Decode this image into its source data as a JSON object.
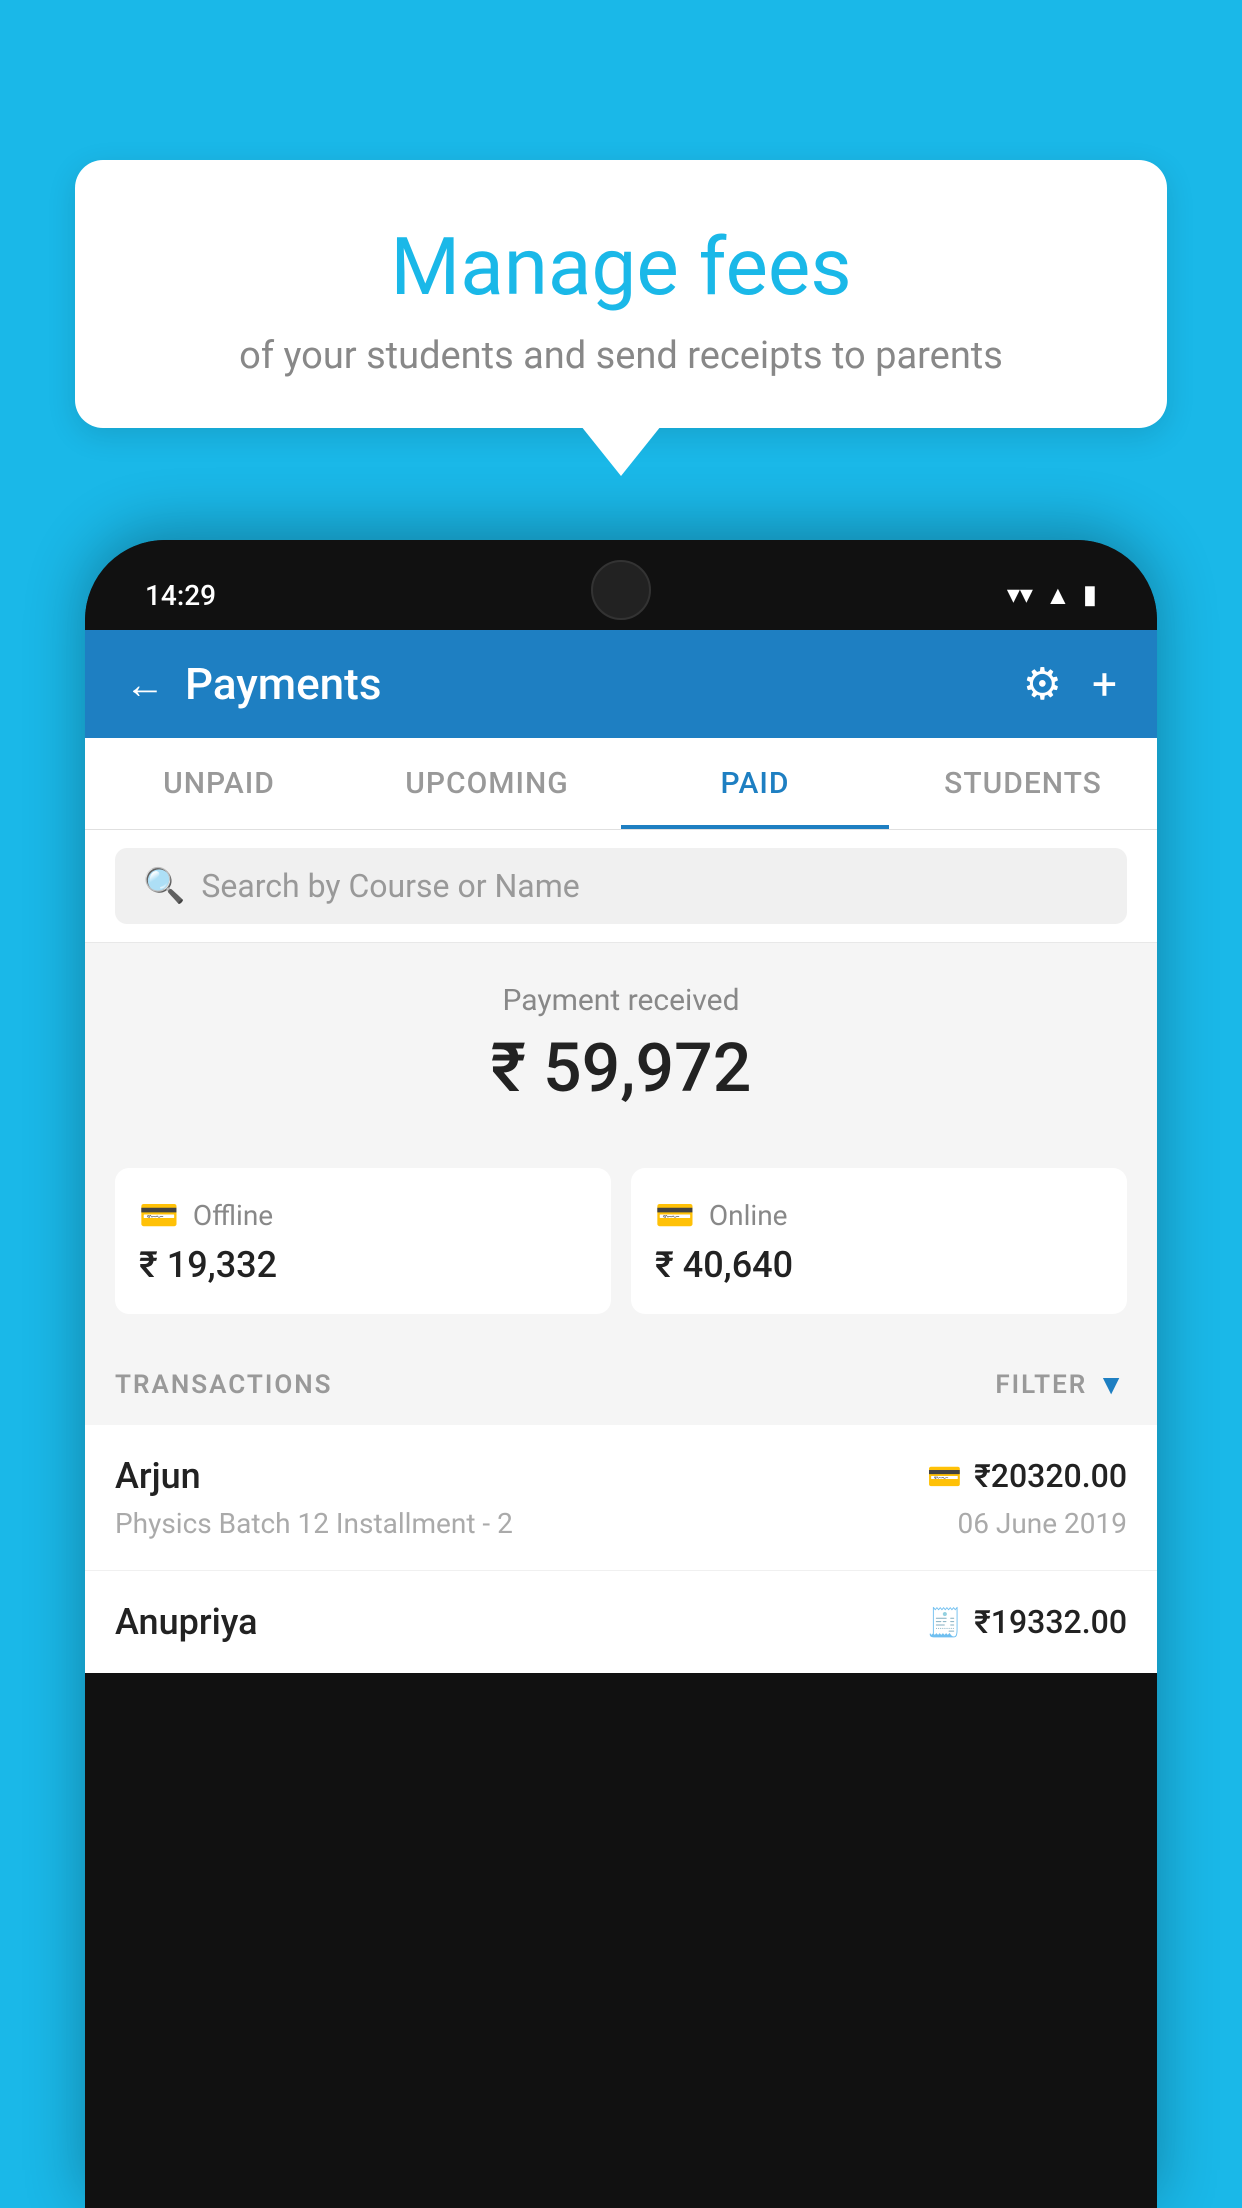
{
  "background_color": "#1ab8e8",
  "bubble": {
    "title": "Manage fees",
    "subtitle": "of your students and send receipts to parents"
  },
  "phone": {
    "status_bar": {
      "time": "14:29",
      "icons": [
        "wifi",
        "signal",
        "battery"
      ]
    },
    "header": {
      "title": "Payments",
      "back_label": "←",
      "gear_label": "⚙",
      "plus_label": "+"
    },
    "tabs": [
      {
        "label": "UNPAID",
        "active": false
      },
      {
        "label": "UPCOMING",
        "active": false
      },
      {
        "label": "PAID",
        "active": true
      },
      {
        "label": "STUDENTS",
        "active": false
      }
    ],
    "search": {
      "placeholder": "Search by Course or Name"
    },
    "payment_summary": {
      "received_label": "Payment received",
      "total_amount": "₹ 59,972",
      "offline": {
        "label": "Offline",
        "amount": "₹ 19,332"
      },
      "online": {
        "label": "Online",
        "amount": "₹ 40,640"
      }
    },
    "transactions": {
      "section_label": "TRANSACTIONS",
      "filter_label": "FILTER",
      "items": [
        {
          "name": "Arjun",
          "detail": "Physics Batch 12 Installment - 2",
          "amount": "₹20320.00",
          "date": "06 June 2019",
          "type": "online"
        },
        {
          "name": "Anupriya",
          "detail": "",
          "amount": "₹19332.00",
          "date": "",
          "type": "offline"
        }
      ]
    }
  }
}
